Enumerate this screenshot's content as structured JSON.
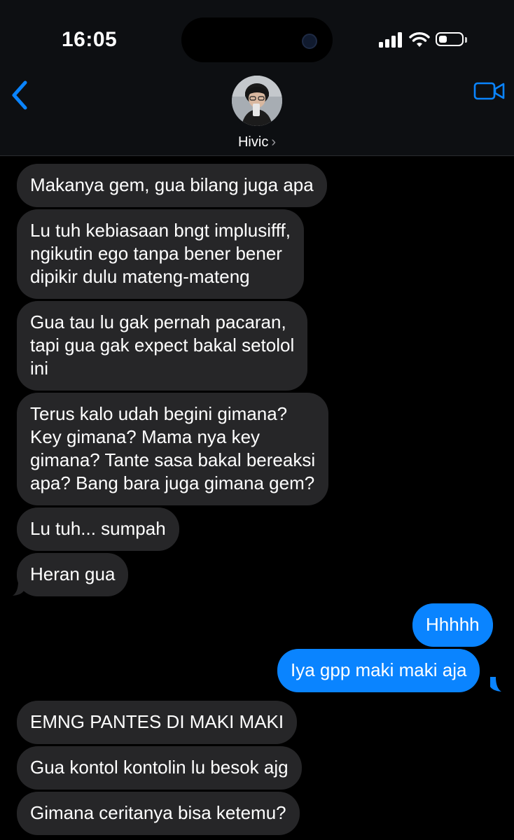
{
  "status_bar": {
    "time": "16:05",
    "battery_level": 0.35
  },
  "header": {
    "contact_name": "Hivic",
    "contact_chevron": "›",
    "icons": {
      "back": "chevron-left-icon",
      "video": "video-camera-icon"
    }
  },
  "colors": {
    "accent": "#0a84ff",
    "incoming_bubble": "#262628",
    "background": "#000000"
  },
  "messages": [
    {
      "side": "incoming",
      "text": "Makanya gem, gua bilang juga apa"
    },
    {
      "side": "incoming",
      "text": "Lu tuh kebiasaan bngt implusifff,\nngikutin ego tanpa bener bener\ndipikir dulu mateng-mateng"
    },
    {
      "side": "incoming",
      "text": "Gua tau lu gak pernah pacaran,\ntapi gua gak expect bakal setolol\nini"
    },
    {
      "side": "incoming",
      "text": "Terus kalo udah begini gimana?\nKey gimana? Mama nya key\ngimana? Tante sasa bakal bereaksi\napa? Bang bara juga gimana gem?"
    },
    {
      "side": "incoming",
      "text": "Lu tuh... sumpah"
    },
    {
      "side": "incoming",
      "text": "Heran gua"
    },
    {
      "side": "outgoing",
      "text": "Hhhhh"
    },
    {
      "side": "outgoing",
      "text": "Iya gpp maki maki aja"
    },
    {
      "side": "incoming",
      "text": "EMNG PANTES DI MAKI MAKI"
    },
    {
      "side": "incoming",
      "text": "Gua kontol kontolin lu besok ajg"
    },
    {
      "side": "incoming",
      "text": "Gimana ceritanya bisa ketemu?"
    }
  ]
}
